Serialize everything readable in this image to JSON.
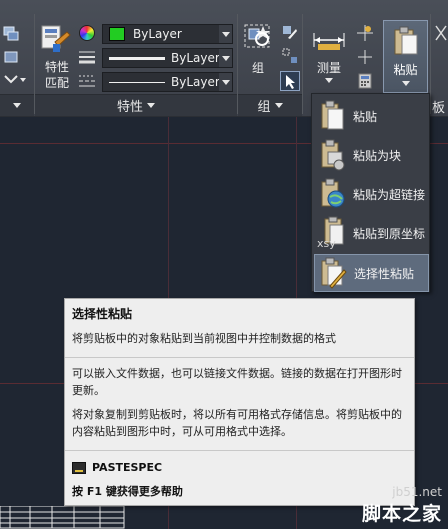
{
  "ribbon": {
    "match_properties": {
      "line1": "特性",
      "line2": "匹配"
    },
    "properties": {
      "color": "ByLayer",
      "lineweight": "ByLayer",
      "linetype": "ByLayer",
      "panel_label": "特性",
      "color_swatch": "#22cc22"
    },
    "group": {
      "button_label": "组",
      "panel_label": "组"
    },
    "measure": {
      "label": "测量"
    },
    "paste": {
      "label": "粘贴"
    },
    "board_partial": "板"
  },
  "paste_menu": {
    "items": [
      {
        "label": "粘贴",
        "icon": "paste-icon"
      },
      {
        "label": "粘贴为块",
        "icon": "paste-as-block-icon"
      },
      {
        "label": "粘贴为超链接",
        "icon": "paste-as-hyperlink-icon"
      },
      {
        "label": "粘贴到原坐标",
        "icon": "paste-to-original-coordinates-icon",
        "icon_text": "xsy"
      },
      {
        "label": "选择性粘贴",
        "icon": "paste-special-icon",
        "selected": true
      }
    ]
  },
  "tooltip": {
    "title": "选择性粘贴",
    "p1": "将剪贴板中的对象粘贴到当前视图中并控制数据的格式",
    "p2": "可以嵌入文件数据，也可以链接文件数据。链接的数据在打开图形时更新。",
    "p3": "将对象复制到剪贴板时，将以所有可用格式存储信息。将剪贴板中的内容粘贴到图形中时，可从可用格式中选择。",
    "command": "PASTESPEC",
    "help": "按 F1 键获得更多帮助"
  },
  "watermark": {
    "url": "jb51.net",
    "name": "脚本之家"
  }
}
